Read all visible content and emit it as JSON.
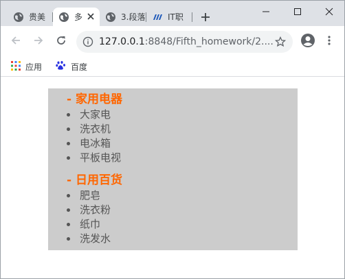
{
  "tabs": [
    {
      "title": "贵美",
      "active": false,
      "favicon": "globe-icon"
    },
    {
      "title": "多",
      "active": true,
      "favicon": "globe-icon"
    },
    {
      "title": "3.段落",
      "active": false,
      "favicon": "globe-icon"
    },
    {
      "title": "IT职",
      "active": false,
      "favicon": "it-logo-icon"
    }
  ],
  "omnibox": {
    "host": "127.0.0.1",
    "rest": ":8848/Fifth_homework/2...."
  },
  "bookmarks": [
    {
      "label": "应用",
      "icon": "apps-grid-icon"
    },
    {
      "label": "百度",
      "icon": "baidu-paw-icon"
    }
  ],
  "content": {
    "sections": [
      {
        "title": "- 家用电器",
        "items": [
          "大家电",
          "洗衣机",
          "电冰箱",
          "平板电视"
        ]
      },
      {
        "title": "- 日用百货",
        "items": [
          "肥皂",
          "洗衣粉",
          "纸巾",
          "洗发水"
        ]
      }
    ]
  },
  "colors": {
    "tabstrip": "#dee1e6",
    "panel": "#cccccc",
    "heading": "#ff6600",
    "item_text": "#555555"
  }
}
